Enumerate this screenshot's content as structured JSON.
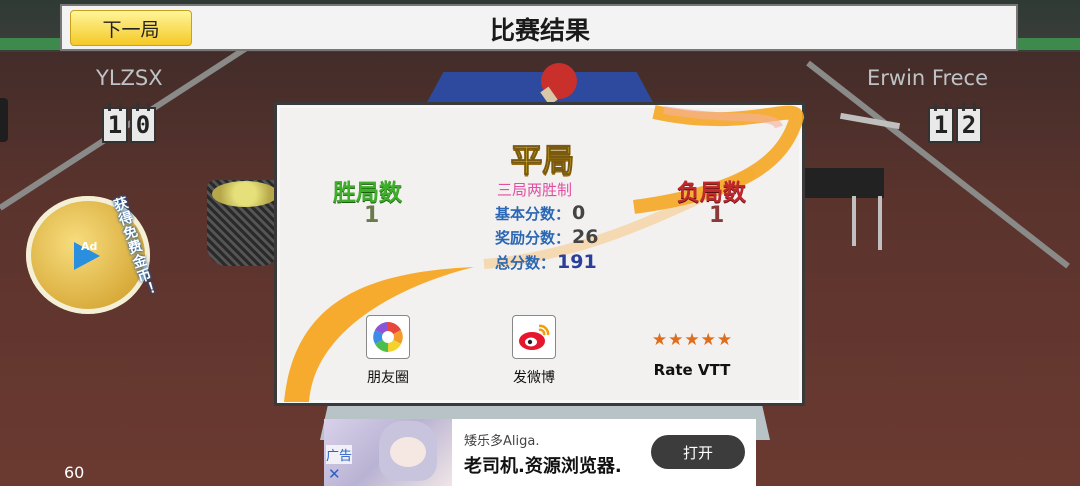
{
  "header": {
    "next_button": "下一局",
    "title": "比赛结果"
  },
  "players": {
    "left": {
      "name": "YLZSX",
      "score_digits": [
        "1",
        "0"
      ]
    },
    "right": {
      "name": "Erwin Frece",
      "score_digits": [
        "1",
        "2"
      ]
    }
  },
  "ad_badge": {
    "label": "Ad",
    "text": "获得免费金币！"
  },
  "result": {
    "outcome": "平局",
    "wins_label": "胜局数",
    "wins_value": "1",
    "losses_label": "负局数",
    "losses_value": "1",
    "rule": "三局两胜制",
    "base_score_label": "基本分数：",
    "base_score_value": "0",
    "bonus_score_label": "奖励分数：",
    "bonus_score_value": "26",
    "total_score_label": "总分数：",
    "total_score_value": "191"
  },
  "share": {
    "moments_label": "朋友圈",
    "weibo_label": "发微博",
    "rate_label": "Rate VTT",
    "rating_stars": 5
  },
  "ad_banner": {
    "tag": "广告",
    "close": "✕",
    "brand": "矮乐多Aliga.",
    "headline": "老司机.资源浏览器.",
    "open_button": "打开"
  },
  "fps": "60",
  "colors": {
    "win_green": "#3fae2a",
    "loss_red": "#c0282e",
    "draw_yellow": "#f5d21e",
    "stat_blue": "#2b67b4",
    "button_yellow": "#f5c926"
  }
}
